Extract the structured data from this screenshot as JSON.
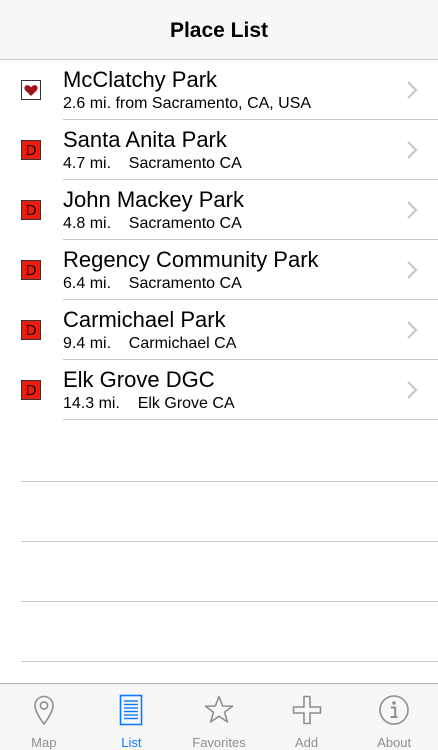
{
  "navbar": {
    "title": "Place List"
  },
  "places": [
    {
      "badge": "heart",
      "name": "McClatchy Park",
      "detail": "2.6 mi. from Sacramento, CA, USA"
    },
    {
      "badge": "D",
      "name": "Santa Anita Park",
      "detail": "4.7 mi.    Sacramento CA"
    },
    {
      "badge": "D",
      "name": "John Mackey Park",
      "detail": "4.8 mi.    Sacramento CA"
    },
    {
      "badge": "D",
      "name": "Regency Community Park",
      "detail": "6.4 mi.    Sacramento CA"
    },
    {
      "badge": "D",
      "name": "Carmichael Park",
      "detail": "9.4 mi.    Carmichael CA"
    },
    {
      "badge": "D",
      "name": "Elk Grove DGC",
      "detail": "14.3 mi.    Elk Grove CA"
    }
  ],
  "badges": {
    "disc": "D"
  },
  "colors": {
    "accent": "#0a7bff",
    "disc_badge": "#ee1c0f",
    "heart": "#a0121a",
    "inactive": "#8e8e93"
  },
  "tabbar": {
    "tabs": [
      {
        "label": "Map",
        "icon": "map-pin-icon",
        "active": false
      },
      {
        "label": "List",
        "icon": "list-icon",
        "active": true
      },
      {
        "label": "Favorites",
        "icon": "star-icon",
        "active": false
      },
      {
        "label": "Add",
        "icon": "plus-icon",
        "active": false
      },
      {
        "label": "About",
        "icon": "info-icon",
        "active": false
      }
    ]
  }
}
